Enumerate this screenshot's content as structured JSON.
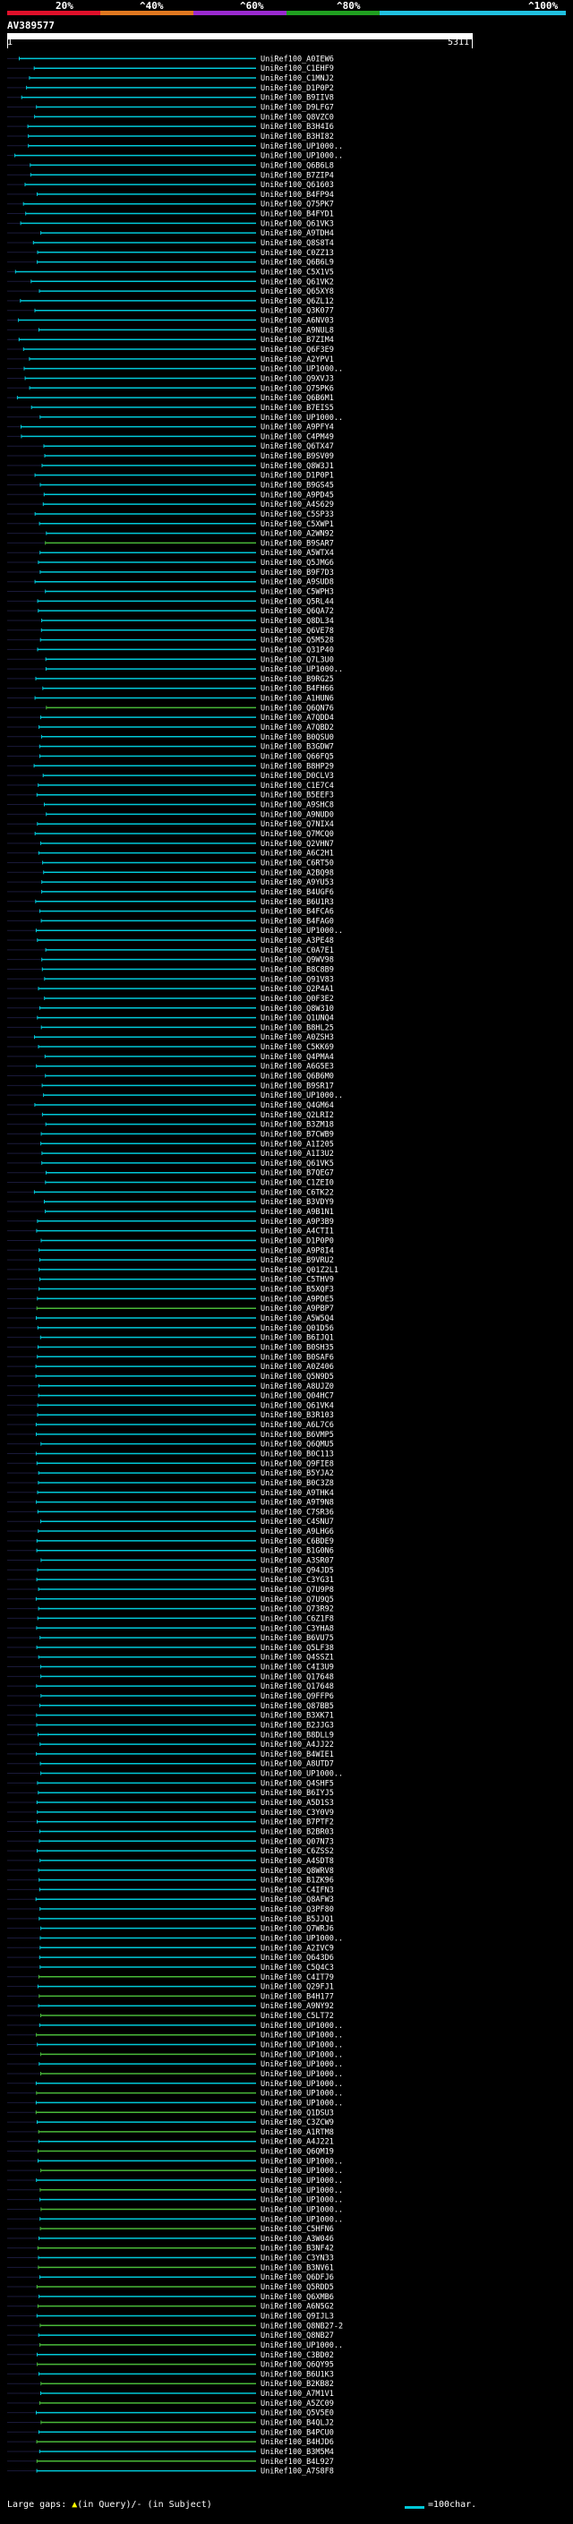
{
  "scale": {
    "labels": [
      "20%",
      "^40%",
      "^60%",
      "^80%",
      "^100%"
    ],
    "colors": [
      "#e0102a",
      "#e07820",
      "#9a2ad0",
      "#20a020",
      "#20c0e0"
    ]
  },
  "query": {
    "name": "AV389577",
    "start": "1",
    "end": "5311"
  },
  "colors": {
    "line_default": "#00c8d8",
    "line_alt": "#48b838",
    "line_dim": "#606060",
    "label": "#ffffff"
  },
  "hits": [
    "UniRef100_A0IEW6",
    "UniRef100_C1EHF9",
    "UniRef100_C1MNJ2",
    "UniRef100_D1P0P2",
    "UniRef100_B9IIV8",
    "UniRef100_D9LFG7",
    "UniRef100_Q8VZC0",
    "UniRef100_B3H4I6",
    "UniRef100_B3HI82",
    "UniRef100_UP1000..",
    "UniRef100_UP1000..",
    "UniRef100_Q6B6L8",
    "UniRef100_B7ZIP4",
    "UniRef100_Q61603",
    "UniRef100_B4FP94",
    "UniRef100_Q75PK7",
    "UniRef100_B4FYD1",
    "UniRef100_Q61VK3",
    "UniRef100_A9TDH4",
    "UniRef100_Q8S8T4",
    "UniRef100_C0ZZ13",
    "UniRef100_Q6B6L9",
    "UniRef100_C5X1V5",
    "UniRef100_Q61VK2",
    "UniRef100_Q65XY8",
    "UniRef100_Q6ZL12",
    "UniRef100_Q3K077",
    "UniRef100_A6NV03",
    "UniRef100_A9NUL8",
    "UniRef100_B7ZIM4",
    "UniRef100_Q6F3E9",
    "UniRef100_A2YPV1",
    "UniRef100_UP1000..",
    "UniRef100_Q9XVJ3",
    "UniRef100_Q75PK6",
    "UniRef100_Q6B6M1",
    "UniRef100_B7EIS5",
    "UniRef100_UP1000..",
    "UniRef100_A9PFY4",
    "UniRef100_C4PM49",
    "UniRef100_Q6TX47",
    "UniRef100_B9SV09",
    "UniRef100_Q8W3J1",
    "UniRef100_D1P0P1",
    "UniRef100_B9GS45",
    "UniRef100_A9PD45",
    "UniRef100_A4S629",
    "UniRef100_C5SP33",
    "UniRef100_C5XWP1",
    "UniRef100_A2WN92",
    "UniRef100_B9SAR7",
    "UniRef100_A5WTX4",
    "UniRef100_Q5JMG6",
    "UniRef100_B9F7D3",
    "UniRef100_A9SUD8",
    "UniRef100_C5WPH3",
    "UniRef100_Q5RL44",
    "UniRef100_Q6QA72",
    "UniRef100_Q8DL34",
    "UniRef100_Q6VE78",
    "UniRef100_Q5M528",
    "UniRef100_Q31P40",
    "UniRef100_Q7L3U0",
    "UniRef100_UP1000..",
    "UniRef100_B9RG25",
    "UniRef100_B4FH66",
    "UniRef100_A1HUN6",
    "UniRef100_Q6QN76",
    "UniRef100_A7QDD4",
    "UniRef100_A7QBD2",
    "UniRef100_B0QSU0",
    "UniRef100_B3GDW7",
    "UniRef100_Q66FQ5",
    "UniRef100_B8HP29",
    "UniRef100_D0CLV3",
    "UniRef100_C1E7C4",
    "UniRef100_B5EEF3",
    "UniRef100_A9SHC8",
    "UniRef100_A9NUD0",
    "UniRef100_Q7NIX4",
    "UniRef100_Q7MCQ0",
    "UniRef100_Q2VHN7",
    "UniRef100_A6C2H1",
    "UniRef100_C6RT50",
    "UniRef100_A2BQ98",
    "UniRef100_A9YU53",
    "UniRef100_B4UGF6",
    "UniRef100_B6U1R3",
    "UniRef100_B4FCA6",
    "UniRef100_B4FAG0",
    "UniRef100_UP1000..",
    "UniRef100_A3PE48",
    "UniRef100_C0A7E1",
    "UniRef100_Q9WV98",
    "UniRef100_B8C8B9",
    "UniRef100_Q91V83",
    "UniRef100_Q2P4A1",
    "UniRef100_Q0F3E2",
    "UniRef100_Q8W310",
    "UniRef100_Q1UNQ4",
    "UniRef100_B8HL25",
    "UniRef100_A0ZSH3",
    "UniRef100_C5KK69",
    "UniRef100_Q4PMA4",
    "UniRef100_A6G5E3",
    "UniRef100_Q6B6M0",
    "UniRef100_B9SR17",
    "UniRef100_UP1000..",
    "UniRef100_Q4GM64",
    "UniRef100_Q2LRI2",
    "UniRef100_B3ZM18",
    "UniRef100_B7CWB9",
    "UniRef100_A1I205",
    "UniRef100_A1I3U2",
    "UniRef100_Q61VK5",
    "UniRef100_B7QEG7",
    "UniRef100_C1ZEI0",
    "UniRef100_C6TK22",
    "UniRef100_B3VDY9",
    "UniRef100_A9B1N1",
    "UniRef100_A9P3B9",
    "UniRef100_A4CTI1",
    "UniRef100_D1P0P0",
    "UniRef100_A9P8I4",
    "UniRef100_B9VRU2",
    "UniRef100_Q01Z2L1",
    "UniRef100_C5THV9",
    "UniRef100_B5XQF3",
    "UniRef100_A9PDE5",
    "UniRef100_A9PBP7",
    "UniRef100_A5W5Q4",
    "UniRef100_Q01D56",
    "UniRef100_B6IJQ1",
    "UniRef100_B0SH35",
    "UniRef100_B0SAF6",
    "UniRef100_A0Z406",
    "UniRef100_Q5N9D5",
    "UniRef100_A8UJZ0",
    "UniRef100_Q04HC7",
    "UniRef100_Q61VK4",
    "UniRef100_B3R103",
    "UniRef100_A6L7C6",
    "UniRef100_B6VMP5",
    "UniRef100_Q6QMU5",
    "UniRef100_B0C113",
    "UniRef100_Q9FIE8",
    "UniRef100_B5YJA2",
    "UniRef100_B0C3Z8",
    "UniRef100_A9THK4",
    "UniRef100_A9T9N8",
    "UniRef100_C7SR36",
    "UniRef100_C4SNU7",
    "UniRef100_A9LHG6",
    "UniRef100_C6BDE9",
    "UniRef100_B1G0N6",
    "UniRef100_A3SR07",
    "UniRef100_Q94JD5",
    "UniRef100_C3YG31",
    "UniRef100_Q7U9P8",
    "UniRef100_Q7U9Q5",
    "UniRef100_Q73R92",
    "UniRef100_C6Z1F8",
    "UniRef100_C3YHA8",
    "UniRef100_B6VU75",
    "UniRef100_Q5LF38",
    "UniRef100_Q4SSZ1",
    "UniRef100_C4I3U9",
    "UniRef100_Q17648",
    "UniRef100_Q17648",
    "UniRef100_Q9FFP6",
    "UniRef100_Q87BB5",
    "UniRef100_B3XK71",
    "UniRef100_B2JJG3",
    "UniRef100_B8DLL9",
    "UniRef100_A4JJ22",
    "UniRef100_B4WIE1",
    "UniRef100_A8UTD7",
    "UniRef100_UP1000..",
    "UniRef100_Q4SHF5",
    "UniRef100_B6IYJ5",
    "UniRef100_A5D1S3",
    "UniRef100_C3Y0V9",
    "UniRef100_B7PTF2",
    "UniRef100_B2BR03",
    "UniRef100_Q07N73",
    "UniRef100_C6ZSS2",
    "UniRef100_A4SDT8",
    "UniRef100_Q8WRV8",
    "UniRef100_B1ZK96",
    "UniRef100_C4IFN3",
    "UniRef100_Q8AFW3",
    "UniRef100_Q3PF80",
    "UniRef100_B5JJQ1",
    "UniRef100_Q7WRJ6",
    "UniRef100_UP1000..",
    "UniRef100_A2IVC9",
    "UniRef100_Q643D6",
    "UniRef100_C5Q4C3",
    "UniRef100_C4IT79",
    "UniRef100_Q29FJ1",
    "UniRef100_B4H177",
    "UniRef100_A9NY92",
    "UniRef100_C5LT72",
    "UniRef100_UP1000..",
    "UniRef100_UP1000..",
    "UniRef100_UP1000..",
    "UniRef100_UP1000..",
    "UniRef100_UP1000..",
    "UniRef100_UP1000..",
    "UniRef100_UP1000..",
    "UniRef100_UP1000..",
    "UniRef100_UP1000..",
    "UniRef100_Q1DSU3",
    "UniRef100_C3ZCW9",
    "UniRef100_A1RTM8",
    "UniRef100_A4J221",
    "UniRef100_Q6QM19",
    "UniRef100_UP1000..",
    "UniRef100_UP1000..",
    "UniRef100_UP1000..",
    "UniRef100_UP1000..",
    "UniRef100_UP1000..",
    "UniRef100_UP1000..",
    "UniRef100_UP1000..",
    "UniRef100_C5HFN6",
    "UniRef100_A3W046",
    "UniRef100_B3NF42",
    "UniRef100_C3YN33",
    "UniRef100_B3NV61",
    "UniRef100_Q6DFJ6",
    "UniRef100_Q5RDD5",
    "UniRef100_Q6XMB6",
    "UniRef100_A6N5G2",
    "UniRef100_Q9IJL3",
    "UniRef100_Q8NB27-2",
    "UniRef100_Q8NB27",
    "UniRef100_UP1000..",
    "UniRef100_C3BD02",
    "UniRef100_Q6QY95",
    "UniRef100_B6U1K3",
    "UniRef100_B2KB82",
    "UniRef100_A7M1V1",
    "UniRef100_A5ZC09",
    "UniRef100_Q5V5E0",
    "UniRef100_B4QLJ2",
    "UniRef100_B4PCU0",
    "UniRef100_B4HJD6",
    "UniRef100_B3M5M4",
    "UniRef100_B4L927",
    "UniRef100_A7S8F8"
  ]
}
